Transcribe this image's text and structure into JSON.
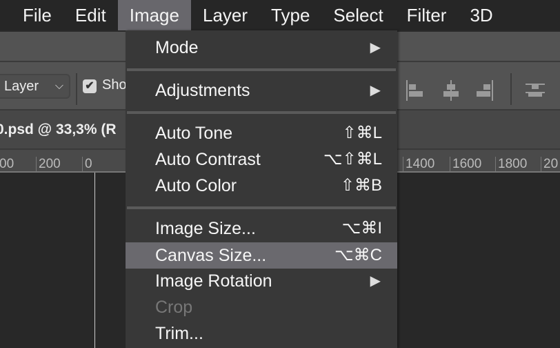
{
  "menubar": {
    "items": [
      "File",
      "Edit",
      "Image",
      "Layer",
      "Type",
      "Select",
      "Filter",
      "3D"
    ],
    "active": "Image"
  },
  "options_bar": {
    "layer_select": "Layer",
    "show_label": "Show",
    "show_checked": true
  },
  "document": {
    "tab_title": "0.psd @ 33,3% (R"
  },
  "ruler": {
    "labels": [
      "00",
      "200",
      "0",
      "1400",
      "1600",
      "1800",
      "20"
    ]
  },
  "image_menu": {
    "items": [
      {
        "label": "Mode",
        "submenu": true
      },
      {
        "label": "Adjustments",
        "submenu": true
      },
      {
        "label": "Auto Tone",
        "shortcut": "⇧⌘L"
      },
      {
        "label": "Auto Contrast",
        "shortcut": "⌥⇧⌘L"
      },
      {
        "label": "Auto Color",
        "shortcut": "⇧⌘B"
      },
      {
        "label": "Image Size...",
        "shortcut": "⌥⌘I"
      },
      {
        "label": "Canvas Size...",
        "shortcut": "⌥⌘C",
        "highlighted": true
      },
      {
        "label": "Image Rotation",
        "submenu": true
      },
      {
        "label": "Crop",
        "disabled": true
      },
      {
        "label": "Trim..."
      }
    ],
    "submenu_arrow": "▶"
  },
  "colors": {
    "menubar": "#262626",
    "menu_bg": "#383838",
    "highlight": "#6a696e",
    "panel": "#535353"
  }
}
